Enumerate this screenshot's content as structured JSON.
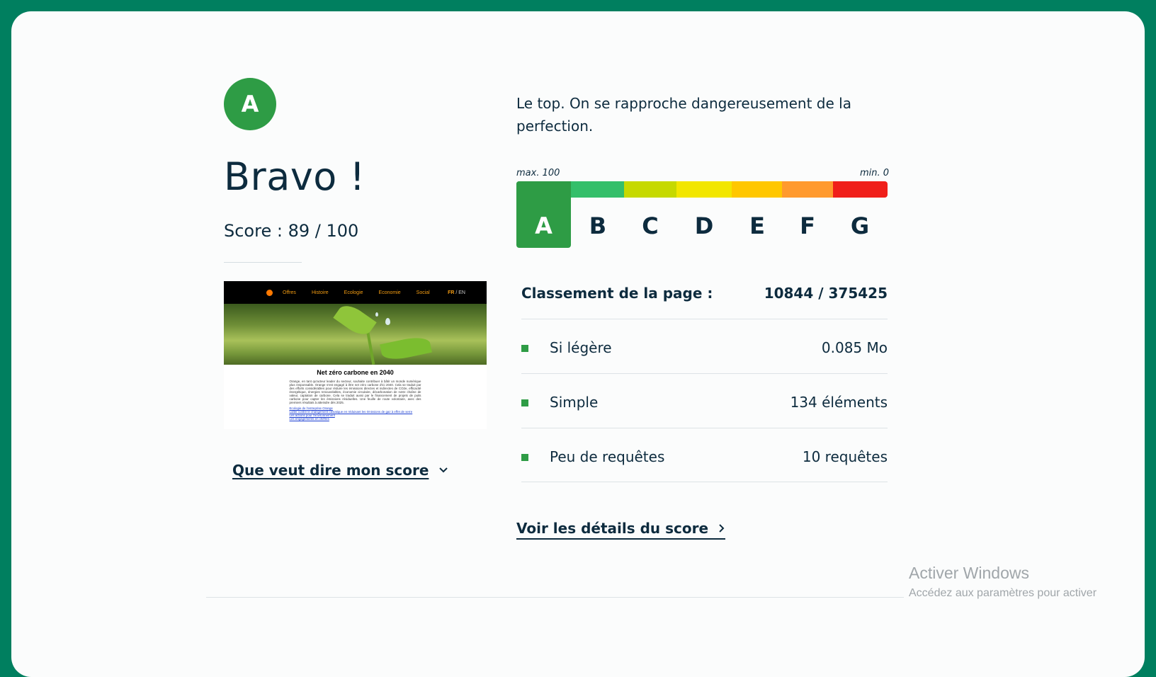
{
  "result": {
    "grade": "A",
    "headline": "Bravo !",
    "score_text": "Score : 89 / 100",
    "score_link": "Que veut dire mon score"
  },
  "thumbnail": {
    "nav_items": [
      "Offres",
      "Histoire",
      "Ecologie",
      "Economie",
      "Social"
    ],
    "lang_fr": "FR",
    "lang_sep": " / ",
    "lang_en": "EN",
    "title": "Net zéro carbone en 2040",
    "paragraph": "Orange, en tant qu'acteur leader du secteur, souhaite contribuer à bâtir un monde numérique plus responsable. Orange s'est engagé à être net zéro carbone d'ici 2040. Cela se traduit par des efforts considérables pour réduire les émissions directes et indirectes de CO2e, efficacité énergétique, énergies renouvelables, économie circulaire, décarbonation de notre chaîne de valeur, captation de carbone. Cela se traduit aussi par le financement de projets de puits carbone pour capter les émissions résiduelles. Une feuille de route volontaire, avec des premiers résultats à atteindre dès 2025.",
    "links": [
      "Ecologie de l'entreprise Orange",
      "Lutter contre le changement climatique en réduisant les émissions de gaz à effet de serre",
      "Les actions pour l'environnement",
      "Les engagements en chiffres"
    ]
  },
  "description": "Le top. On se rapproche dangereusement de la perfection.",
  "scale": {
    "max_label": "max. 100",
    "min_label": "min. 0",
    "grades": [
      "A",
      "B",
      "C",
      "D",
      "E",
      "F",
      "G"
    ],
    "active_grade": "A",
    "colors": [
      "#2e9c45",
      "#34bf6a",
      "#c6d900",
      "#f2e600",
      "#ffc700",
      "#ff9a2e",
      "#f01f1a"
    ]
  },
  "ranking": {
    "label": "Classement de la page :",
    "value": "10844 / 375425"
  },
  "metrics": [
    {
      "label": "Si légère",
      "value": "0.085 Mo"
    },
    {
      "label": "Simple",
      "value": "134 éléments"
    },
    {
      "label": "Peu de requêtes",
      "value": "10 requêtes"
    }
  ],
  "details_link": "Voir les détails du score",
  "windows_watermark": {
    "title": "Activer Windows",
    "subtitle": "Accédez aux paramètres pour activer"
  }
}
